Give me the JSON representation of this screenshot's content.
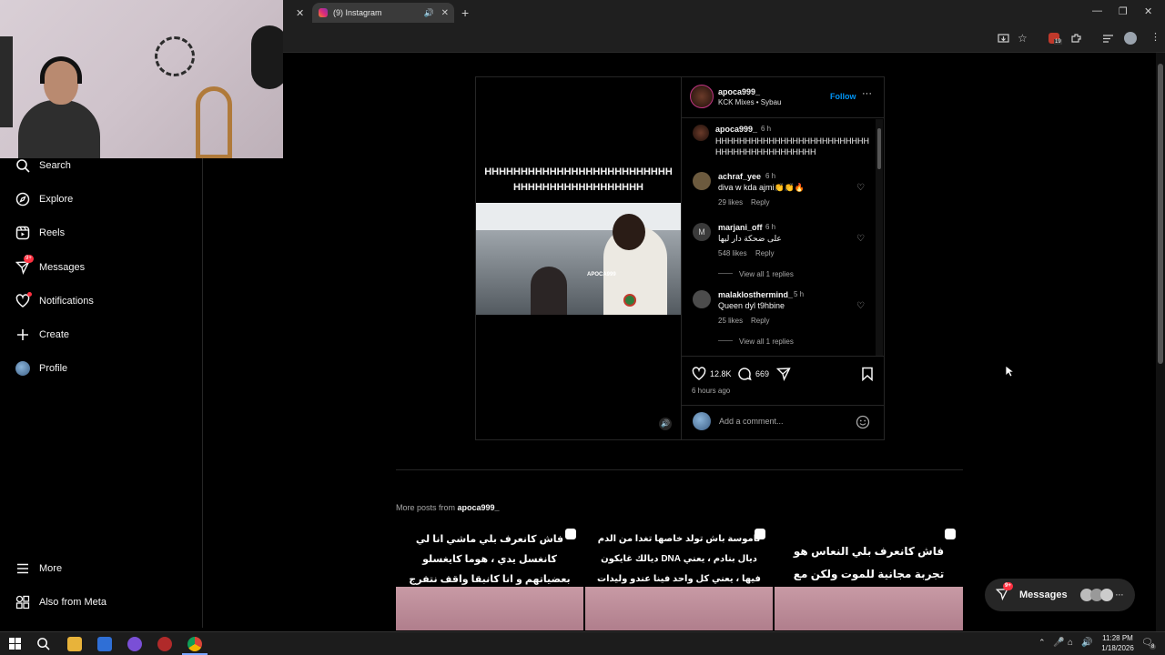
{
  "browser": {
    "tab_title": "(9) Instagram",
    "close_glyph": "✕",
    "newtab_glyph": "+",
    "mute_glyph": "🔊",
    "extension_badge": "19",
    "window_buttons": [
      "—",
      "❐",
      "✕"
    ]
  },
  "sidebar": {
    "items": [
      {
        "label": "Search",
        "icon": "search-icon"
      },
      {
        "label": "Explore",
        "icon": "compass-icon"
      },
      {
        "label": "Reels",
        "icon": "reels-icon"
      },
      {
        "label": "Messages",
        "icon": "messenger-icon",
        "badge": "9+"
      },
      {
        "label": "Notifications",
        "icon": "heart-icon",
        "dot": true
      },
      {
        "label": "Create",
        "icon": "plus-icon"
      },
      {
        "label": "Profile",
        "icon": "avatar-icon"
      }
    ],
    "more_label": "More",
    "meta_label": "Also from Meta"
  },
  "post": {
    "username": "apoca999_",
    "subtitle": "KCK Mixes • Sybau",
    "follow_label": "Follow",
    "overlay_text": "HHHHHHHHHHHHHHHHHHHHHHHHHHHHHHHHHHHHHHHHHHHH",
    "watermark": "APOCA999",
    "caption": {
      "user": "apoca999_",
      "time": "6 h",
      "text": "HHHHHHHHHHHHHHHHHHHHHHHHHHHHHHHHHHHHHHHHHHH"
    },
    "comments": [
      {
        "user": "achraf_yee",
        "time": "6 h",
        "text": "diva w kda ajmi👏👏🔥",
        "likes": "29 likes",
        "reply": "Reply",
        "view_replies": ""
      },
      {
        "user": "marjani_off",
        "time": "6 h",
        "text": "على ضحكة دار ليها",
        "likes": "548 likes",
        "reply": "Reply",
        "view_replies": "View all 1 replies"
      },
      {
        "user": "malaklosthermind_",
        "time": "5 h",
        "text": "Queen dyl t9hbine",
        "likes": "25 likes",
        "reply": "Reply",
        "view_replies": "View all 1 replies"
      }
    ],
    "like_count": "12.8K",
    "comment_count": "669",
    "posted_ago": "6 hours ago",
    "comment_placeholder": "Add a comment..."
  },
  "more_posts": {
    "prefix": "More posts from ",
    "user": "apoca999_",
    "thumbs": [
      {
        "text": "فاش كانعرف بلي ماشي انا لي كانغسل يدي ، هوما كايغسلو بعضياتهم و انا كانبقا واقف نتفرج فيهم تايساليو"
      },
      {
        "text": "ناموسة باش تولد خاصها تغدا من الدم ديال بنادم ، يعني DNA ديالك غايكون فيها ، يعني كل واحد فينا عندو وليدات مع ناموسة"
      },
      {
        "text": "فاش كانعرف بلي النعاس هو تجربة مجانية للموت ولكن مع الإعلانات"
      }
    ]
  },
  "messages_float": {
    "label": "Messages",
    "badge": "9+"
  },
  "taskbar": {
    "time": "11:28 PM",
    "date": "1/18/2026",
    "notif_count": "8"
  }
}
